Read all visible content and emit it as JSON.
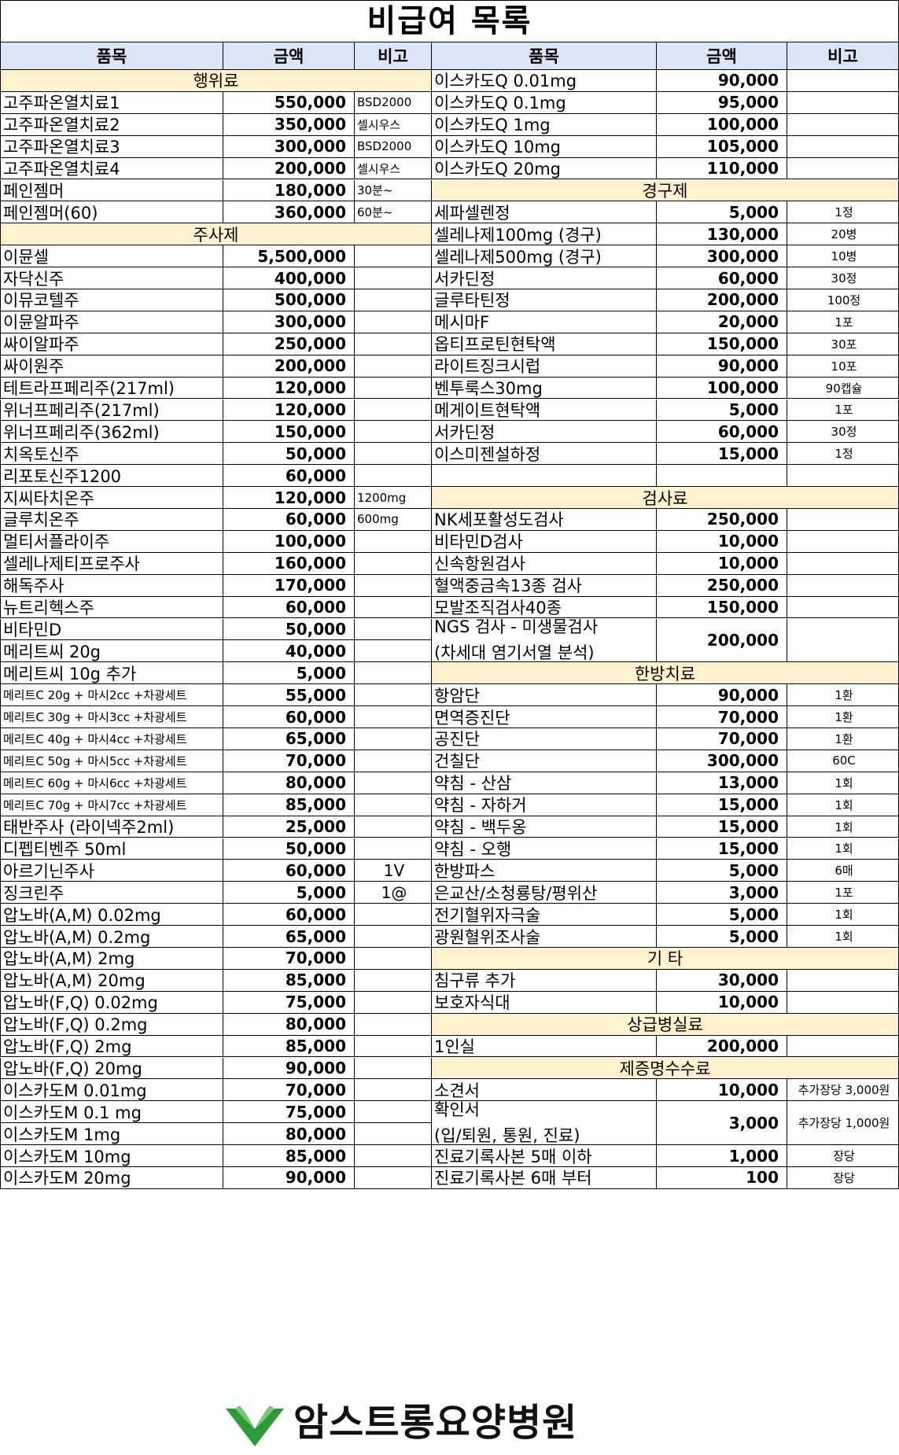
{
  "title": "비급여 목록",
  "headers": {
    "item": "품목",
    "price": "금액",
    "note": "비고"
  },
  "left": [
    {
      "s": "행위료"
    },
    {
      "n": "고주파온열치료1",
      "p": "550,000",
      "t": "BSD2000"
    },
    {
      "n": "고주파온열치료2",
      "p": "350,000",
      "t": "셀시우스"
    },
    {
      "n": "고주파온열치료3",
      "p": "300,000",
      "t": "BSD2000"
    },
    {
      "n": "고주파온열치료4",
      "p": "200,000",
      "t": "셀시우스"
    },
    {
      "n": "페인젬머",
      "p": "180,000",
      "t": "30분~"
    },
    {
      "n": "페인젬머(60)",
      "p": "360,000",
      "t": "60분~"
    },
    {
      "s": "주사제"
    },
    {
      "n": "이뮨셀",
      "p": "5,500,000",
      "t": ""
    },
    {
      "n": "자닥신주",
      "p": "400,000",
      "t": ""
    },
    {
      "n": "이뮤코텔주",
      "p": "500,000",
      "t": ""
    },
    {
      "n": "이뮨알파주",
      "p": "300,000",
      "t": ""
    },
    {
      "n": "싸이알파주",
      "p": "250,000",
      "t": ""
    },
    {
      "n": "싸이원주",
      "p": "200,000",
      "t": ""
    },
    {
      "n": "테트라프페리주(217ml)",
      "p": "120,000",
      "t": ""
    },
    {
      "n": "위너프페리주(217ml)",
      "p": "120,000",
      "t": ""
    },
    {
      "n": "위너프페리주(362ml)",
      "p": "150,000",
      "t": ""
    },
    {
      "n": "치옥토신주",
      "p": "50,000",
      "t": ""
    },
    {
      "n": "리포토신주1200",
      "p": "60,000",
      "t": ""
    },
    {
      "n": "지씨타치온주",
      "p": "120,000",
      "t": "1200mg"
    },
    {
      "n": "글루치온주",
      "p": "60,000",
      "t": "600mg"
    },
    {
      "n": "멀티서플라이주",
      "p": "100,000",
      "t": ""
    },
    {
      "n": "셀레나제티프로주사",
      "p": "160,000",
      "t": ""
    },
    {
      "n": "해독주사",
      "p": "170,000",
      "t": ""
    },
    {
      "n": "뉴트리헥스주",
      "p": "60,000",
      "t": ""
    },
    {
      "n": "비타민D",
      "p": "50,000",
      "t": ""
    },
    {
      "n": "메리트씨 20g",
      "p": "40,000",
      "t": ""
    },
    {
      "n": "메리트씨 10g 추가",
      "p": "5,000",
      "t": ""
    },
    {
      "n": "메리트C 20g + 마시2cc +차광세트",
      "p": "55,000",
      "t": "",
      "sm": 1
    },
    {
      "n": "메리트C 30g + 마시3cc +차광세트",
      "p": "60,000",
      "t": "",
      "sm": 1
    },
    {
      "n": "메리트C 40g + 마시4cc +차광세트",
      "p": "65,000",
      "t": "",
      "sm": 1
    },
    {
      "n": "메리트C 50g + 마시5cc +차광세트",
      "p": "70,000",
      "t": "",
      "sm": 1
    },
    {
      "n": "메리트C 60g + 마시6cc +차광세트",
      "p": "80,000",
      "t": "",
      "sm": 1
    },
    {
      "n": "메리트C 70g + 마시7cc +차광세트",
      "p": "85,000",
      "t": "",
      "sm": 1
    },
    {
      "n": "태반주사 (라이넥주2ml)",
      "p": "25,000",
      "t": ""
    },
    {
      "n": "디펩티벤주 50ml",
      "p": "50,000",
      "t": ""
    },
    {
      "n": "아르기닌주사",
      "p": "60,000",
      "t": "1V",
      "big": 1
    },
    {
      "n": "징크린주",
      "p": "5,000",
      "t": "1@",
      "big": 1
    },
    {
      "n": "압노바(A,M) 0.02mg",
      "p": "60,000",
      "t": ""
    },
    {
      "n": "압노바(A,M) 0.2mg",
      "p": "65,000",
      "t": ""
    },
    {
      "n": "압노바(A,M) 2mg",
      "p": "70,000",
      "t": ""
    },
    {
      "n": "압노바(A,M) 20mg",
      "p": "85,000",
      "t": ""
    },
    {
      "n": "압노바(F,Q) 0.02mg",
      "p": "75,000",
      "t": ""
    },
    {
      "n": "압노바(F,Q) 0.2mg",
      "p": "80,000",
      "t": ""
    },
    {
      "n": "압노바(F,Q) 2mg",
      "p": "85,000",
      "t": ""
    },
    {
      "n": "압노바(F,Q) 20mg",
      "p": "90,000",
      "t": ""
    },
    {
      "n": "이스카도M 0.01mg",
      "p": "70,000",
      "t": ""
    },
    {
      "n": "이스카도M 0.1 mg",
      "p": "75,000",
      "t": ""
    },
    {
      "n": "이스카도M 1mg",
      "p": "80,000",
      "t": ""
    },
    {
      "n": "이스카도M 10mg",
      "p": "85,000",
      "t": ""
    },
    {
      "n": "이스카도M 20mg",
      "p": "90,000",
      "t": ""
    }
  ],
  "right": [
    {
      "n": "이스카도Q 0.01mg",
      "p": "90,000",
      "t": ""
    },
    {
      "n": "이스카도Q 0.1mg",
      "p": "95,000",
      "t": ""
    },
    {
      "n": "이스카도Q 1mg",
      "p": "100,000",
      "t": ""
    },
    {
      "n": "이스카도Q 10mg",
      "p": "105,000",
      "t": ""
    },
    {
      "n": "이스카도Q 20mg",
      "p": "110,000",
      "t": ""
    },
    {
      "s": "경구제"
    },
    {
      "n": "세파셀렌정",
      "p": "5,000",
      "t": "1정"
    },
    {
      "n": "셀레나제100mg (경구)",
      "p": "130,000",
      "t": "20병"
    },
    {
      "n": "셀레나제500mg (경구)",
      "p": "300,000",
      "t": "10병"
    },
    {
      "n": "서카딘정",
      "p": "60,000",
      "t": "30정"
    },
    {
      "n": "글루타틴정",
      "p": "200,000",
      "t": "100정"
    },
    {
      "n": "메시마F",
      "p": "20,000",
      "t": "1포"
    },
    {
      "n": "옵티프로틴현탁액",
      "p": "150,000",
      "t": "30포"
    },
    {
      "n": "라이트징크시럽",
      "p": "90,000",
      "t": "10포"
    },
    {
      "n": "벤투룩스30mg",
      "p": "100,000",
      "t": "90캡슐"
    },
    {
      "n": "메게이트현탁액",
      "p": "5,000",
      "t": "1포"
    },
    {
      "n": "서카딘정",
      "p": "60,000",
      "t": "30정"
    },
    {
      "n": "이스미젠설하정",
      "p": "15,000",
      "t": "1정"
    },
    {
      "n": "",
      "p": "",
      "t": ""
    },
    {
      "s": "검사료"
    },
    {
      "n": "NK세포활성도검사",
      "p": "250,000",
      "t": ""
    },
    {
      "n": "비타민D검사",
      "p": "10,000",
      "t": ""
    },
    {
      "n": "신속항원검사",
      "p": "10,000",
      "t": ""
    },
    {
      "n": "혈액중금속13종 검사",
      "p": "250,000",
      "t": ""
    },
    {
      "n": "모발조직검사40종",
      "p": "150,000",
      "t": ""
    },
    {
      "n": "NGS 검사 - 미생물검사",
      "n2": "(차세대 염기서열 분석)",
      "p": "200,000",
      "t": "",
      "span": 2
    },
    {
      "s": "한방치료"
    },
    {
      "n": "항암단",
      "p": "90,000",
      "t": "1환"
    },
    {
      "n": "면역증진단",
      "p": "70,000",
      "t": "1환"
    },
    {
      "n": "공진단",
      "p": "70,000",
      "t": "1환"
    },
    {
      "n": "건칠단",
      "p": "300,000",
      "t": "60C"
    },
    {
      "n": "약침 - 산삼",
      "p": "13,000",
      "t": "1회"
    },
    {
      "n": "약침 - 자하거",
      "p": "15,000",
      "t": "1회"
    },
    {
      "n": "약침 - 백두옹",
      "p": "15,000",
      "t": "1회"
    },
    {
      "n": "약침 - 오행",
      "p": "15,000",
      "t": "1회"
    },
    {
      "n": "한방파스",
      "p": "5,000",
      "t": "6매"
    },
    {
      "n": "은교산/소청룡탕/평위산",
      "p": "3,000",
      "t": "1포"
    },
    {
      "n": "전기혈위자극술",
      "p": "5,000",
      "t": "1회"
    },
    {
      "n": "광원혈위조사술",
      "p": "5,000",
      "t": "1회"
    },
    {
      "s": "기        타"
    },
    {
      "n": "침구류 추가",
      "p": "30,000",
      "t": ""
    },
    {
      "n": "보호자식대",
      "p": "10,000",
      "t": ""
    },
    {
      "s": "상급병실료"
    },
    {
      "n": "1인실",
      "p": "200,000",
      "t": ""
    },
    {
      "s": "제증명수수료"
    },
    {
      "n": "소견서",
      "p": "10,000",
      "t": "추가장당 3,000원"
    },
    {
      "n": "확인서",
      "n2": "(입/퇴원, 통원, 진료)",
      "p": "3,000",
      "t": "추가장당 1,000원",
      "span": 2
    },
    {
      "n": "진료기록사본 5매 이하",
      "p": "1,000",
      "t": "장당"
    },
    {
      "n": "진료기록사본 6매 부터",
      "p": "100",
      "t": "장당"
    }
  ],
  "logo": {
    "name": "암스트롱요양병원",
    "icon": "leaf-logo-icon",
    "color": "#2e9a3c"
  }
}
